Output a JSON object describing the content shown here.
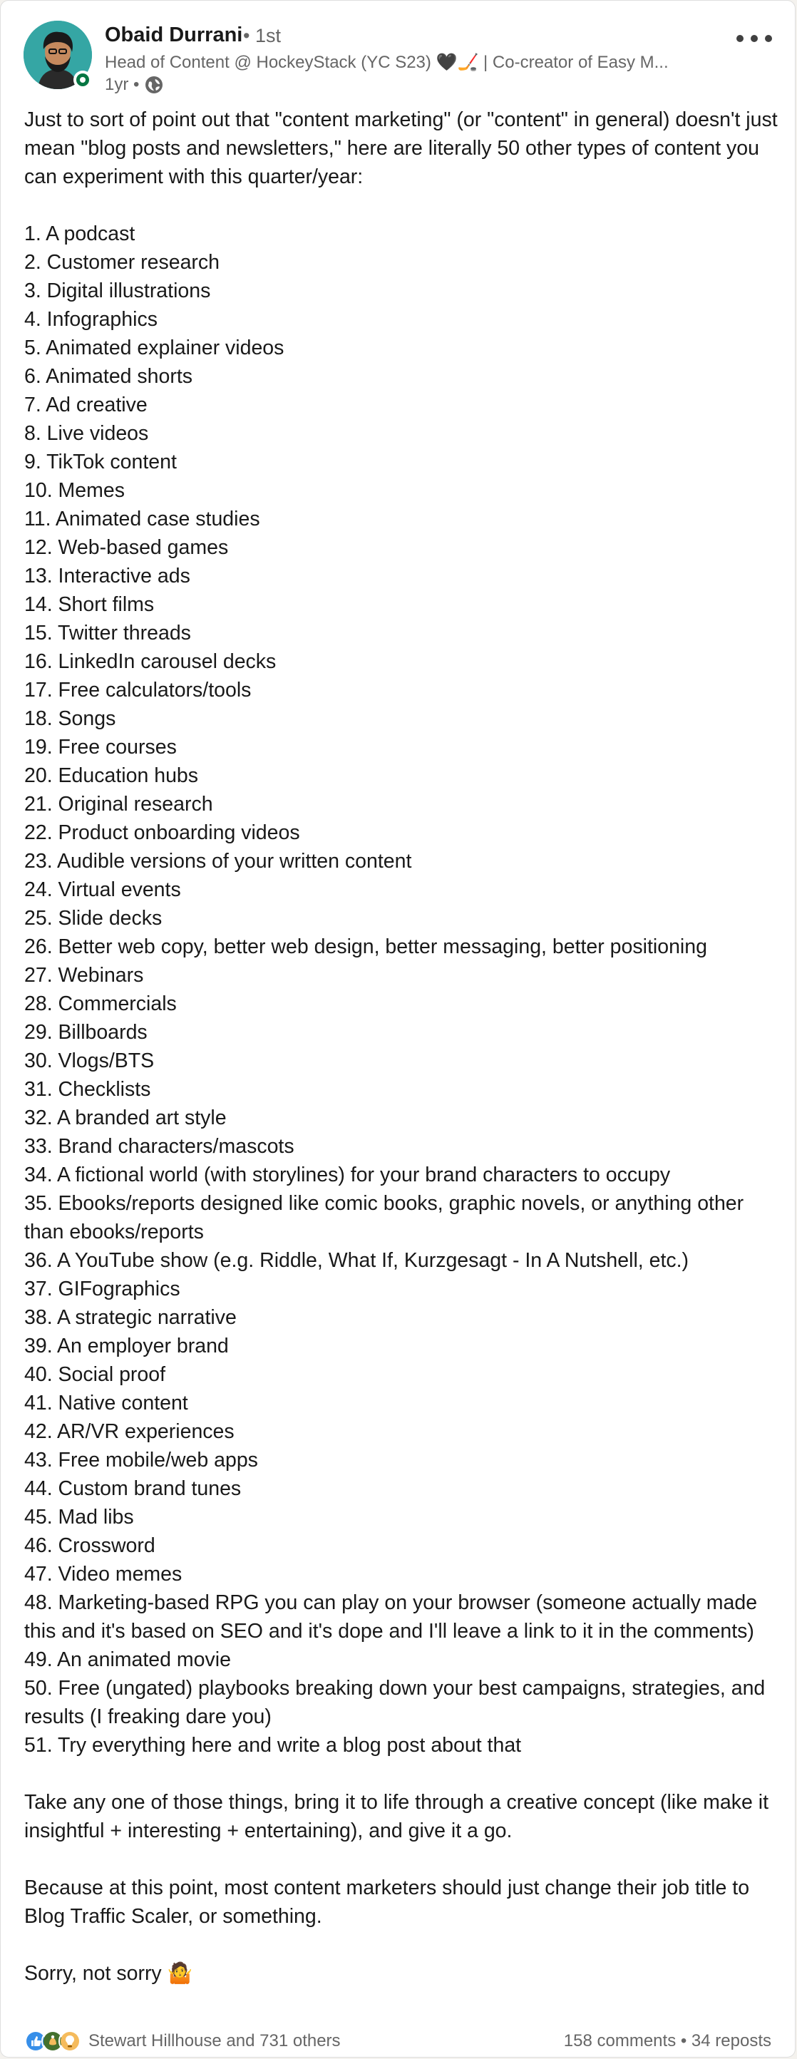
{
  "author": {
    "name": "Obaid Durrani",
    "connection": "• 1st",
    "headline": "Head of Content @ HockeyStack (YC S23) 🖤🏒 | Co-creator of Easy M...",
    "time": "1yr •"
  },
  "post": {
    "intro": "Just to sort of point out that \"content marketing\" (or \"content\" in general) doesn't just mean \"blog posts and newsletters,\" here are literally 50 other types of content you can experiment with this quarter/year:",
    "items": [
      "1. A podcast",
      "2. Customer research",
      "3. Digital illustrations",
      "4. Infographics",
      "5. Animated explainer videos",
      "6. Animated shorts",
      "7. Ad creative",
      "8. Live videos",
      "9. TikTok content",
      "10. Memes",
      "11. Animated case studies",
      "12. Web-based games",
      "13. Interactive ads",
      "14. Short films",
      "15. Twitter threads",
      "16. LinkedIn carousel decks",
      "17. Free calculators/tools",
      "18. Songs",
      "19. Free courses",
      "20. Education hubs",
      "21. Original research",
      "22. Product onboarding videos",
      "23. Audible versions of your written content",
      "24. Virtual events",
      "25. Slide decks",
      "26. Better web copy, better web design, better messaging, better positioning",
      "27. Webinars",
      "28. Commercials",
      "29. Billboards",
      "30. Vlogs/BTS",
      "31. Checklists",
      "32. A branded art style",
      "33. Brand characters/mascots",
      "34. A fictional world (with storylines) for your brand characters to occupy",
      "35. Ebooks/reports designed like comic books, graphic novels, or anything other than ebooks/reports",
      "36. A YouTube show (e.g. Riddle, What If, Kurzgesagt - In A Nutshell, etc.)",
      "37. GIFographics",
      "38. A strategic narrative",
      "39. An employer brand",
      "40. Social proof",
      "41. Native content",
      "42. AR/VR experiences",
      "43. Free mobile/web apps",
      "44. Custom brand tunes",
      "45. Mad libs",
      "46. Crossword",
      "47. Video memes",
      "48. Marketing-based RPG you can play on your browser (someone actually made this and it's based on SEO and it's dope and I'll leave a link to it in the comments)",
      "49. An animated movie",
      "50. Free (ungated) playbooks breaking down your best campaigns, strategies, and results (I freaking dare you)",
      "51. Try everything here and write a blog post about that"
    ],
    "paragraph2": "Take any one of those things, bring it to life through a creative concept (like make it insightful + interesting + entertaining), and give it a go.",
    "paragraph3": "Because at this point, most content marketers should just change their job title to Blog Traffic Scaler, or something.",
    "closing": "Sorry, not sorry 🤷"
  },
  "social": {
    "reactions_text": "Stewart Hillhouse and 731 others",
    "counts_text": "158 comments • 34 reposts",
    "reaction_icons": [
      "like-reaction-icon",
      "celebrate-reaction-icon",
      "insightful-reaction-icon"
    ]
  },
  "colors": {
    "accent_teal": "#35a6a4",
    "presence_green": "#057642",
    "secondary_text": "#666666",
    "like_blue": "#378fe9",
    "celebrate_green": "#44712e",
    "insightful_yellow": "#f5bb5c"
  },
  "icons": {
    "visibility": "globe-icon",
    "menu": "more-options-icon"
  }
}
